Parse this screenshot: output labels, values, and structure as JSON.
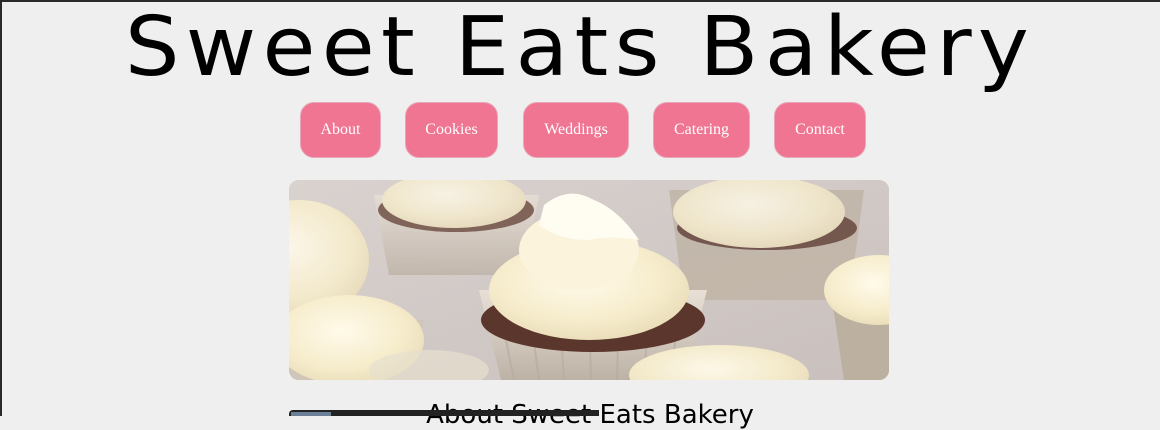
{
  "header": {
    "title": "Sweet Eats Bakery"
  },
  "nav": {
    "items": [
      {
        "label": "About"
      },
      {
        "label": "Cookies"
      },
      {
        "label": "Weddings"
      },
      {
        "label": "Catering"
      },
      {
        "label": "Contact"
      }
    ],
    "button_color": "#ef7592"
  },
  "hero": {
    "image": "cupcakes-with-buttercream-frosting"
  },
  "about": {
    "heading": "About Sweet Eats Bakery"
  },
  "colors": {
    "background": "#efefef",
    "accent": "#ef7592",
    "text": "#000000"
  }
}
